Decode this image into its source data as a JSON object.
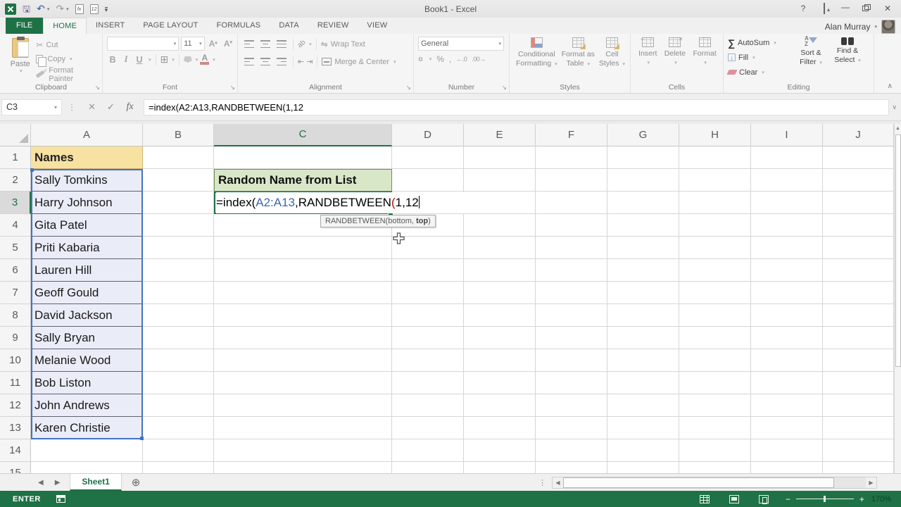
{
  "window": {
    "title": "Book1 - Excel",
    "help": "?",
    "user": "Alan Murray"
  },
  "tabs": {
    "file": "FILE",
    "items": [
      "HOME",
      "INSERT",
      "PAGE LAYOUT",
      "FORMULAS",
      "DATA",
      "REVIEW",
      "VIEW"
    ],
    "active": "HOME"
  },
  "ribbon": {
    "clipboard": {
      "label": "Clipboard",
      "paste": "Paste",
      "cut": "Cut",
      "copy": "Copy",
      "format_painter": "Format Painter"
    },
    "font": {
      "label": "Font",
      "name": "",
      "size": "11",
      "bold": "B",
      "italic": "I",
      "underline": "U",
      "grow": "A",
      "shrink": "A",
      "color": "A"
    },
    "alignment": {
      "label": "Alignment",
      "orientation": "ab",
      "wrap": "Wrap Text",
      "merge": "Merge & Center"
    },
    "number": {
      "label": "Number",
      "format": "General",
      "accounting": "¤",
      "percent": "%",
      "comma": ",",
      "inc_decimal": "←.0",
      "dec_decimal": ".00→"
    },
    "styles": {
      "label": "Styles",
      "cond1": "Conditional",
      "cond2": "Formatting",
      "fmt1": "Format as",
      "fmt2": "Table",
      "cs1": "Cell",
      "cs2": "Styles"
    },
    "cells": {
      "label": "Cells",
      "insert": "Insert",
      "delete": "Delete",
      "format": "Format"
    },
    "editing": {
      "label": "Editing",
      "autosum": "AutoSum",
      "fill": "Fill",
      "clear": "Clear",
      "sortA": "A",
      "sortZ": "Z",
      "sort1": "Sort &",
      "sort2": "Filter",
      "find1": "Find &",
      "find2": "Select"
    }
  },
  "formula_bar": {
    "name_box": "C3",
    "cancel": "✕",
    "enter": "✓",
    "fx": "fx",
    "formula": "=index(A2:A13,RANDBETWEEN(1,12"
  },
  "grid": {
    "columns": [
      "A",
      "B",
      "C",
      "D",
      "E",
      "F",
      "G",
      "H",
      "I",
      "J"
    ],
    "active_column": "C",
    "active_row": "3",
    "rows": [
      {
        "num": "1",
        "a": "Names"
      },
      {
        "num": "2",
        "a": "Sally Tomkins"
      },
      {
        "num": "3",
        "a": "Harry Johnson"
      },
      {
        "num": "4",
        "a": "Gita Patel"
      },
      {
        "num": "5",
        "a": "Priti Kabaria"
      },
      {
        "num": "6",
        "a": "Lauren Hill"
      },
      {
        "num": "7",
        "a": "Geoff Gould"
      },
      {
        "num": "8",
        "a": "David Jackson"
      },
      {
        "num": "9",
        "a": "Sally Bryan"
      },
      {
        "num": "10",
        "a": "Melanie Wood"
      },
      {
        "num": "11",
        "a": "Bob Liston"
      },
      {
        "num": "12",
        "a": "John Andrews"
      },
      {
        "num": "13",
        "a": "Karen Christie"
      },
      {
        "num": "14",
        "a": ""
      },
      {
        "num": "15",
        "a": ""
      }
    ],
    "c2": "Random Name from List",
    "edit": {
      "parts": [
        {
          "text": "=index(",
          "color": "#000000"
        },
        {
          "text": "A2:A13",
          "color": "#3C66B0"
        },
        {
          "text": ",RANDBETWEEN",
          "color": "#000000"
        },
        {
          "text": "(",
          "color": "#C00000"
        },
        {
          "text": "1,12",
          "color": "#000000"
        }
      ]
    },
    "tooltip": {
      "pre": "RANDBETWEEN(bottom, ",
      "bold": "top",
      "post": ")"
    }
  },
  "sheet_bar": {
    "sheet1": "Sheet1"
  },
  "status_bar": {
    "mode": "ENTER",
    "zoom_pct": "170%"
  },
  "colors": {
    "excel_green": "#1E7245",
    "range_reference_blue": "#4472C4",
    "names_header_fill": "#F7E2A2",
    "names_range_fill": "#EAEDF7",
    "c2_fill": "#D9E7C9",
    "paren_red": "#C00000"
  }
}
